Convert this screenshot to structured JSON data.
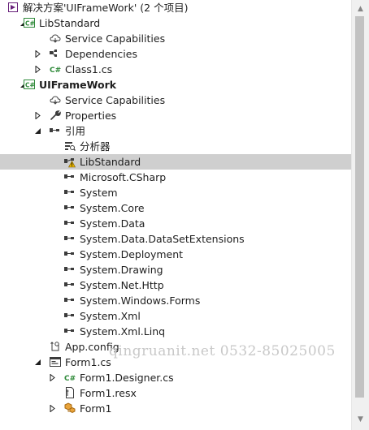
{
  "solution": {
    "label": "解决方案'UIFrameWork' (2 个项目)"
  },
  "tree": [
    {
      "label": "解决方案'UIFrameWork' (2 个项目)",
      "icon": "solution-icon",
      "expander": "",
      "level": 0,
      "bold": false
    },
    {
      "label": "LibStandard",
      "icon": "csharp-project-icon",
      "expander": "expanded",
      "level": 0,
      "bold": false
    },
    {
      "label": "Service Capabilities",
      "icon": "service-capabilities-icon",
      "expander": "",
      "level": 1,
      "bold": false
    },
    {
      "label": "Dependencies",
      "icon": "dependencies-icon",
      "expander": "collapsed",
      "level": 1,
      "bold": false
    },
    {
      "label": "Class1.cs",
      "icon": "csharp-file-icon",
      "expander": "collapsed",
      "level": 1,
      "bold": false
    },
    {
      "label": "UIFrameWork",
      "icon": "csharp-project-icon",
      "expander": "expanded",
      "level": 0,
      "bold": true
    },
    {
      "label": "Service Capabilities",
      "icon": "service-capabilities-icon",
      "expander": "",
      "level": 1,
      "bold": false
    },
    {
      "label": "Properties",
      "icon": "wrench-icon",
      "expander": "collapsed",
      "level": 1,
      "bold": false
    },
    {
      "label": "引用",
      "icon": "references-icon",
      "expander": "expanded",
      "level": 1,
      "bold": false
    },
    {
      "label": "分析器",
      "icon": "analyzer-icon",
      "expander": "",
      "level": 2,
      "bold": false
    },
    {
      "label": "LibStandard",
      "icon": "warning-reference-icon",
      "expander": "",
      "level": 2,
      "bold": false,
      "selected": true
    },
    {
      "label": "Microsoft.CSharp",
      "icon": "reference-icon",
      "expander": "",
      "level": 2,
      "bold": false
    },
    {
      "label": "System",
      "icon": "reference-icon",
      "expander": "",
      "level": 2,
      "bold": false
    },
    {
      "label": "System.Core",
      "icon": "reference-icon",
      "expander": "",
      "level": 2,
      "bold": false
    },
    {
      "label": "System.Data",
      "icon": "reference-icon",
      "expander": "",
      "level": 2,
      "bold": false
    },
    {
      "label": "System.Data.DataSetExtensions",
      "icon": "reference-icon",
      "expander": "",
      "level": 2,
      "bold": false
    },
    {
      "label": "System.Deployment",
      "icon": "reference-icon",
      "expander": "",
      "level": 2,
      "bold": false
    },
    {
      "label": "System.Drawing",
      "icon": "reference-icon",
      "expander": "",
      "level": 2,
      "bold": false
    },
    {
      "label": "System.Net.Http",
      "icon": "reference-icon",
      "expander": "",
      "level": 2,
      "bold": false
    },
    {
      "label": "System.Windows.Forms",
      "icon": "reference-icon",
      "expander": "",
      "level": 2,
      "bold": false
    },
    {
      "label": "System.Xml",
      "icon": "reference-icon",
      "expander": "",
      "level": 2,
      "bold": false
    },
    {
      "label": "System.Xml.Linq",
      "icon": "reference-icon",
      "expander": "",
      "level": 2,
      "bold": false
    },
    {
      "label": "App.config",
      "icon": "config-file-icon",
      "expander": "",
      "level": 1,
      "bold": false
    },
    {
      "label": "Form1.cs",
      "icon": "form-icon",
      "expander": "expanded",
      "level": 1,
      "bold": false
    },
    {
      "label": "Form1.Designer.cs",
      "icon": "csharp-file-icon",
      "expander": "collapsed",
      "level": 2,
      "bold": false
    },
    {
      "label": "Form1.resx",
      "icon": "resx-file-icon",
      "expander": "",
      "level": 2,
      "bold": false
    },
    {
      "label": "Form1",
      "icon": "class-icon",
      "expander": "collapsed",
      "level": 2,
      "bold": false
    }
  ],
  "watermark": "qingruanit.net 0532-85025005",
  "colors": {
    "selection": "#cfcfcf",
    "csharp_green": "#2f8a3a",
    "reference": "#3c3c3c",
    "warning": "#e8b400",
    "solution_purple": "#68217a"
  }
}
